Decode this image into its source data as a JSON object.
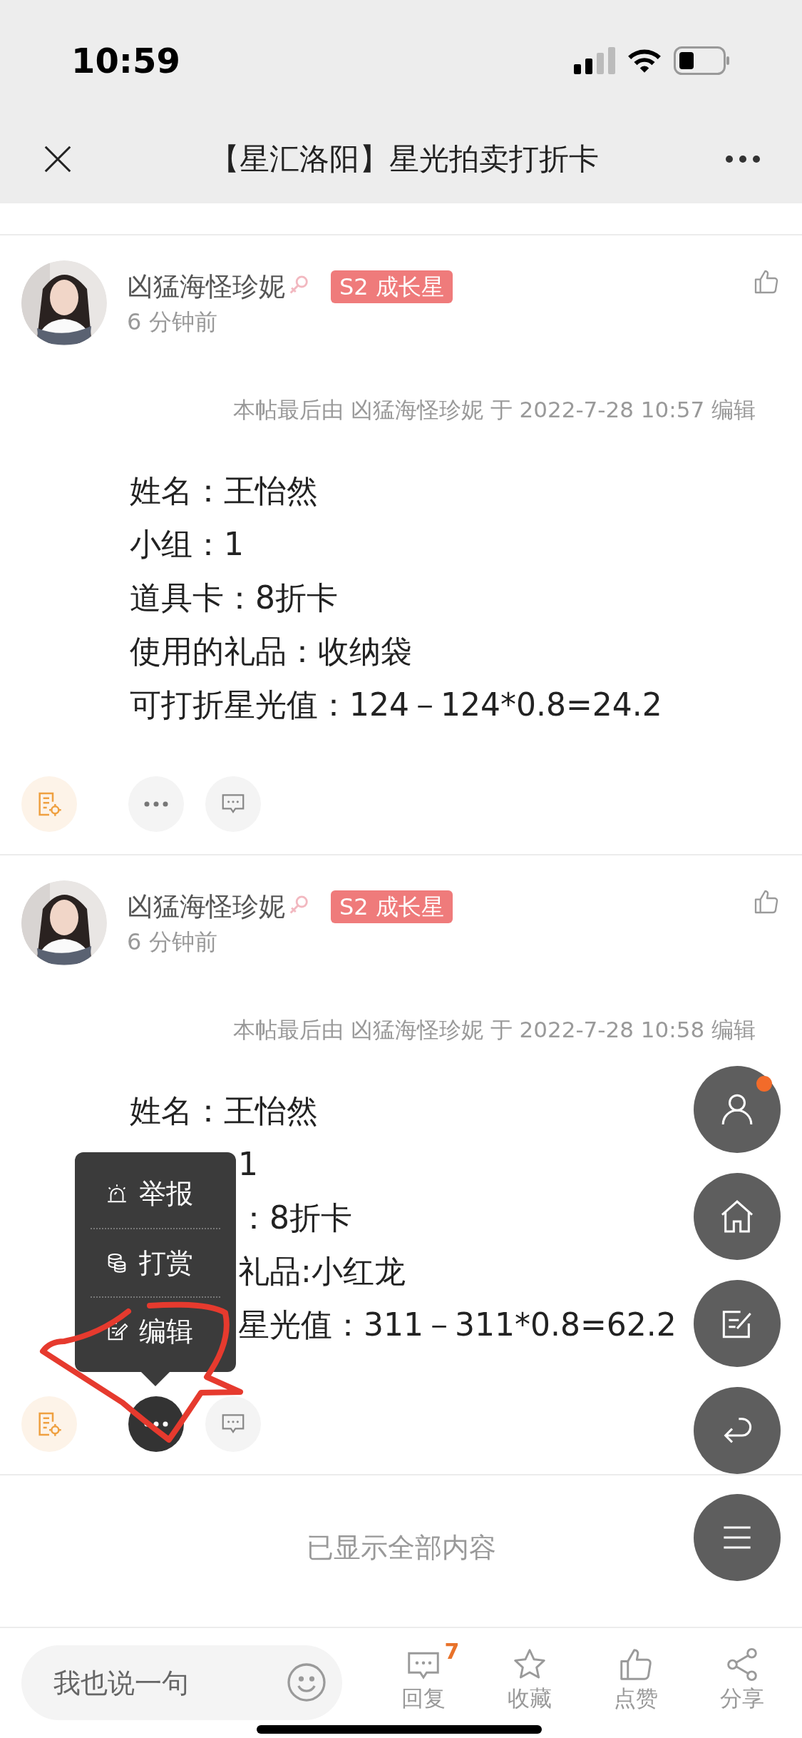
{
  "status_bar": {
    "time": "10:59"
  },
  "nav": {
    "title": "【星汇洛阳】星光拍卖打折卡"
  },
  "posts": [
    {
      "author": "凶猛海怪珍妮",
      "badge": "S2 成长星",
      "time": "6 分钟前",
      "edit_note": "本帖最后由 凶猛海怪珍妮 于 2022-7-28 10:57 编辑",
      "liked": false,
      "menu_open": false,
      "lines": [
        {
          "text": "姓名：王怡然",
          "kind": "full"
        },
        {
          "text": "小组：1",
          "kind": "full"
        },
        {
          "text": "道具卡：8折卡",
          "kind": "full"
        },
        {
          "text": "使用的礼品：收纳袋",
          "kind": "full"
        },
        {
          "text": "可打折星光值：124－124*0.8=24.2",
          "kind": "full"
        }
      ]
    },
    {
      "author": "凶猛海怪珍妮",
      "badge": "S2 成长星",
      "time": "6 分钟前",
      "edit_note": "本帖最后由 凶猛海怪珍妮 于 2022-7-28 10:58 编辑",
      "liked": false,
      "menu_open": true,
      "lines": [
        {
          "text": "姓名：王怡然",
          "kind": "full"
        },
        {
          "text": "1",
          "kind": "covered"
        },
        {
          "text": "：8折卡",
          "kind": "covered"
        },
        {
          "text": "礼品:小红龙",
          "kind": "covered"
        },
        {
          "text": "星光值：311－311*0.8=62.2",
          "kind": "covered"
        }
      ],
      "menu": [
        {
          "label": "举报",
          "kind": "report"
        },
        {
          "label": "打赏",
          "kind": "reward"
        },
        {
          "label": "编辑",
          "kind": "edit"
        }
      ]
    }
  ],
  "footer_note": "已显示全部内容",
  "floating_buttons": [
    {
      "kind": "profile",
      "dot": true
    },
    {
      "kind": "home",
      "dot": false
    },
    {
      "kind": "compose",
      "dot": false
    },
    {
      "kind": "back",
      "dot": false
    },
    {
      "kind": "menu",
      "dot": false
    }
  ],
  "bottom_bar": {
    "placeholder": "我也说一句",
    "actions": [
      {
        "kind": "reply",
        "label": "回复",
        "count": "7"
      },
      {
        "kind": "favorite",
        "label": "收藏"
      },
      {
        "kind": "like",
        "label": "点赞"
      },
      {
        "kind": "share",
        "label": "分享"
      }
    ]
  }
}
